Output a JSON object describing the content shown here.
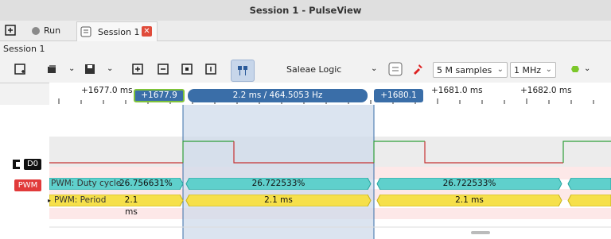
{
  "window": {
    "title": "Session 1 - PulseView"
  },
  "tabs": {
    "run_label": "Run",
    "session_label": "Session 1"
  },
  "session_name": "Session 1",
  "toolbar": {
    "device": "Saleae Logic",
    "samples": "5 M samples",
    "rate": "1 MHz"
  },
  "ruler": {
    "ticks": [
      "+1677.0 ms",
      "+1681.0 ms",
      "+1682.0 ms"
    ],
    "cursor_left": "+1677.9 ms",
    "cursor_mid": "2.2 ms / 464.5053 Hz",
    "cursor_right": "+1680.1 ms"
  },
  "channels": {
    "d0": "D0",
    "decoder": "PWM",
    "row_duty": "PWM: Duty cycle",
    "row_period": "PWM: Period"
  },
  "annotations": {
    "duty": [
      "26.756631%",
      "26.722533%",
      "26.722533%"
    ],
    "period": [
      "2.1 ms",
      "2.1 ms",
      "2.1 ms"
    ]
  },
  "colors": {
    "cursor": "#3a6ea8",
    "duty": "#5fd0cc",
    "period": "#f6e04a",
    "signal_high": "#2f9e3a",
    "signal_low": "#c63232"
  }
}
